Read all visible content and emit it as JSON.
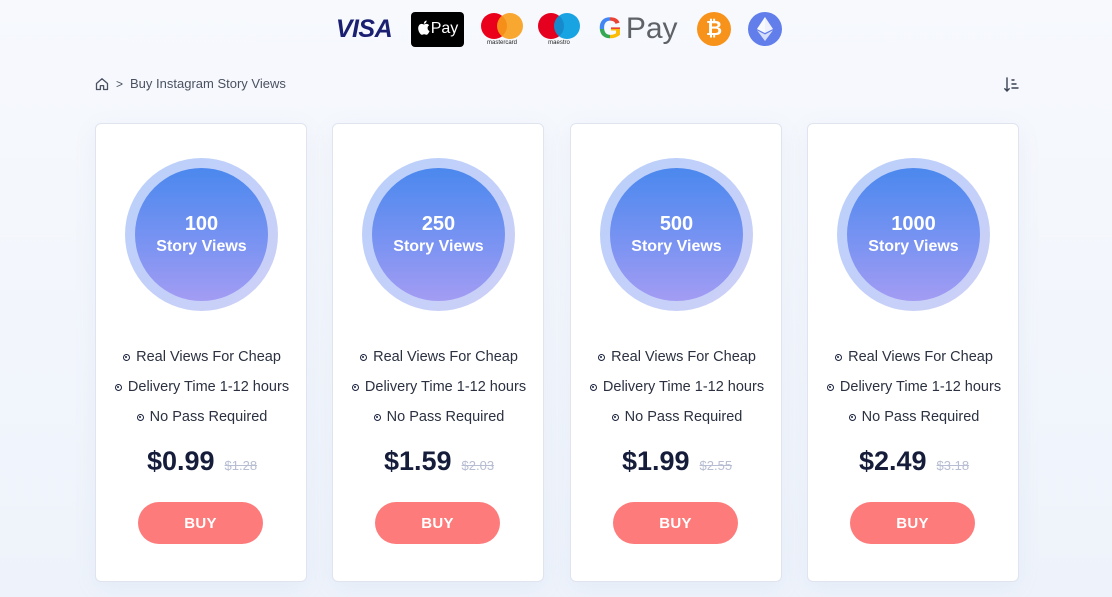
{
  "payments": {
    "visa": "VISA",
    "apple_pay": "Pay",
    "mastercard": "mastercard",
    "maestro": "maestro",
    "google_pay_g": "G",
    "google_pay_word": "Pay",
    "bitcoin_symbol": "₿",
    "icons": [
      "visa-logo",
      "apple-pay-logo",
      "mastercard-logo",
      "maestro-logo",
      "google-pay-logo",
      "bitcoin-icon",
      "ethereum-icon"
    ]
  },
  "breadcrumb": {
    "separator": ">",
    "current": "Buy Instagram Story Views"
  },
  "colors": {
    "buy_button": "#fd7b7b",
    "price_text": "#151d3b",
    "orb_top": "#4b88ee",
    "orb_bottom": "#a39cf3"
  },
  "packages": [
    {
      "amount": "100",
      "unit": "Story Views",
      "features": [
        "Real Views For Cheap",
        "Delivery Time 1-12 hours",
        "No Pass Required"
      ],
      "price": "$0.99",
      "old_price": "$1.28",
      "buy_label": "BUY"
    },
    {
      "amount": "250",
      "unit": "Story Views",
      "features": [
        "Real Views For Cheap",
        "Delivery Time 1-12 hours",
        "No Pass Required"
      ],
      "price": "$1.59",
      "old_price": "$2.03",
      "buy_label": "BUY"
    },
    {
      "amount": "500",
      "unit": "Story Views",
      "features": [
        "Real Views For Cheap",
        "Delivery Time 1-12 hours",
        "No Pass Required"
      ],
      "price": "$1.99",
      "old_price": "$2.55",
      "buy_label": "BUY"
    },
    {
      "amount": "1000",
      "unit": "Story Views",
      "features": [
        "Real Views For Cheap",
        "Delivery Time 1-12 hours",
        "No Pass Required"
      ],
      "price": "$2.49",
      "old_price": "$3.18",
      "buy_label": "BUY"
    }
  ]
}
